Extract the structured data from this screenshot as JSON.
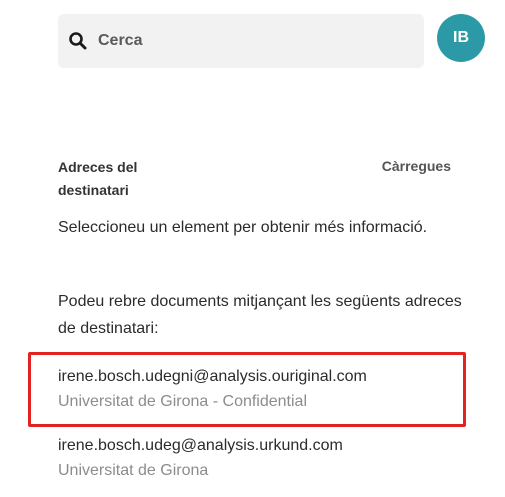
{
  "search": {
    "placeholder": "Cerca"
  },
  "avatar": {
    "initials": "IB",
    "color": "#2b9aa6"
  },
  "headings": {
    "left": "Adreces del destinatari",
    "right": "Càrregues"
  },
  "info": {
    "select_prompt": "Seleccioneu un element per obtenir més informació.",
    "addresses_intro": "Podeu rebre documents mitjançant les següents adreces de destinatari:"
  },
  "addresses": [
    {
      "email": "irene.bosch.udegni@analysis.ouriginal.com",
      "org": "Universitat de Girona - Confidential",
      "highlighted": true
    },
    {
      "email": "irene.bosch.udeg@analysis.urkund.com",
      "org": "Universitat de Girona",
      "highlighted": false
    }
  ],
  "colors": {
    "highlight_border": "#e32222",
    "muted_text": "#8c8c8c"
  }
}
